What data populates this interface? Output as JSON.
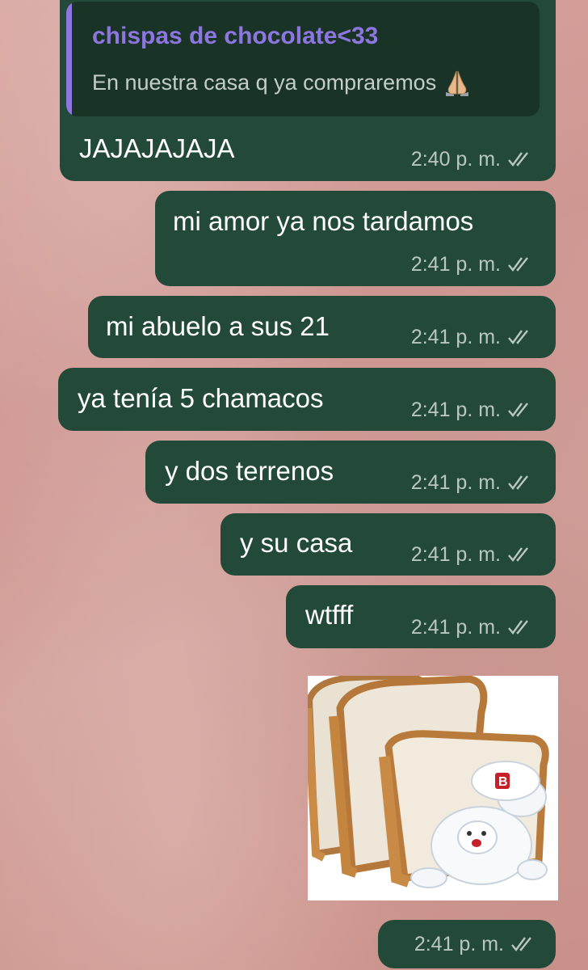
{
  "quoted_reply": {
    "author": "chispas de chocolate<33",
    "text": "En nuestra casa q ya compraremos",
    "emoji": "folded-hands"
  },
  "messages": [
    {
      "text": "JAJAJAJAJA",
      "time": "2:40 p. m.",
      "status": "read"
    },
    {
      "text": "mi amor ya nos tardamos",
      "time": "2:41 p. m.",
      "status": "read"
    },
    {
      "text": "mi abuelo a sus 21",
      "time": "2:41 p. m.",
      "status": "read"
    },
    {
      "text": "ya tenía 5 chamacos",
      "time": "2:41 p. m.",
      "status": "read"
    },
    {
      "text": "y dos terrenos",
      "time": "2:41 p. m.",
      "status": "read"
    },
    {
      "text": "y su casa",
      "time": "2:41 p. m.",
      "status": "read"
    },
    {
      "text": "wtfff",
      "time": "2:41 p. m.",
      "status": "read"
    }
  ],
  "sticker": {
    "description_icon": "bread-bear-sticker",
    "time": "2:41 p. m.",
    "status": "read"
  },
  "colors": {
    "bubble": "#234a39",
    "quote_bg": "#1a3327",
    "quote_accent": "#8d76e0",
    "meta": "#b9c7bf",
    "wallpaper": "#d4a29c"
  }
}
